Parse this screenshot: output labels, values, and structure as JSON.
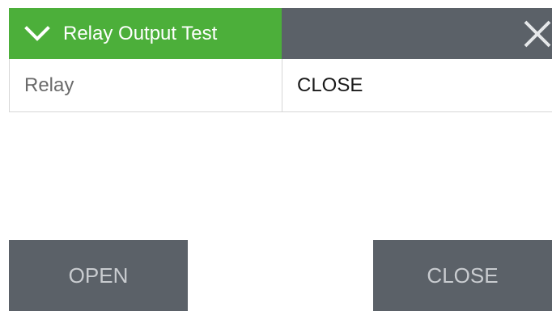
{
  "header": {
    "title": "Relay Output Test",
    "expand_icon": "chevron-down-icon",
    "close_icon": "close-icon",
    "accent_color": "#4caf3a",
    "bar_color": "#5b6168"
  },
  "relay_row": {
    "label": "Relay",
    "value": "CLOSE"
  },
  "buttons": {
    "open_label": "OPEN",
    "close_label": "CLOSE"
  }
}
